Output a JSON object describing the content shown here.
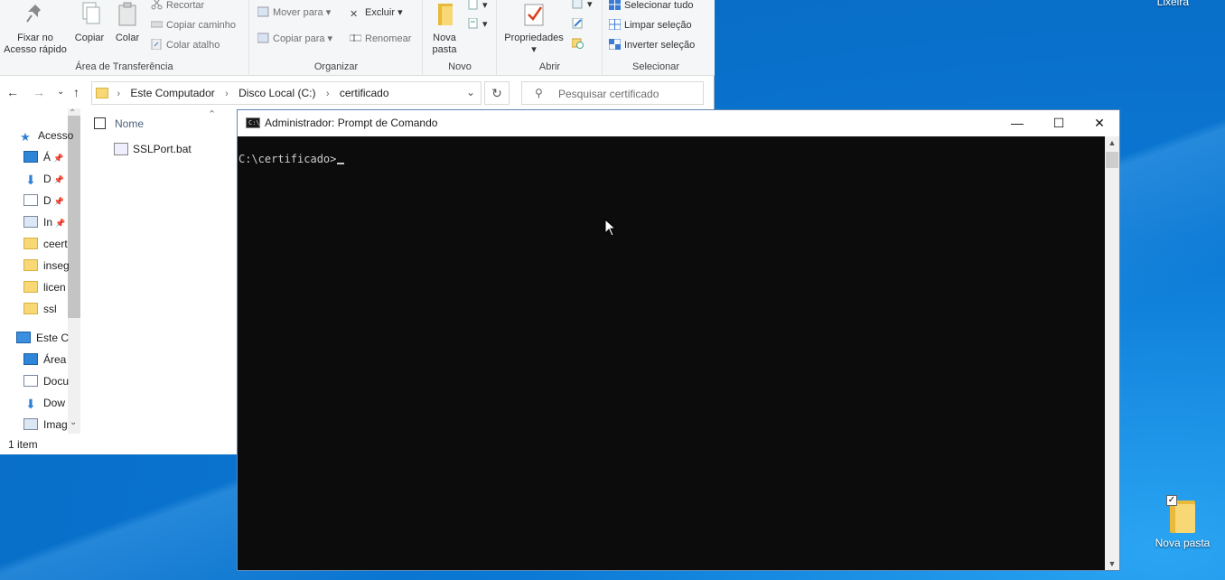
{
  "desktop": {
    "top_label": "Lixeira",
    "icon_label": "Nova pasta"
  },
  "ribbon": {
    "clipboard": {
      "group_label": "Área de Transferência",
      "pin_label_1": "Fixar no",
      "pin_label_2": "Acesso rápido",
      "copy": "Copiar",
      "paste": "Colar",
      "cut": "Recortar",
      "copy_path": "Copiar caminho",
      "paste_shortcut": "Colar atalho"
    },
    "organize": {
      "group_label": "Organizar",
      "move_to": "Mover para",
      "copy_to": "Copiar para",
      "delete": "Excluir",
      "rename": "Renomear"
    },
    "new": {
      "group_label": "Novo",
      "new_folder_1": "Nova",
      "new_folder_2": "pasta"
    },
    "open": {
      "group_label": "Abrir",
      "properties": "Propriedades"
    },
    "select": {
      "group_label": "Selecionar",
      "select_all": "Selecionar tudo",
      "clear_selection": "Limpar seleção",
      "invert_selection": "Inverter seleção"
    }
  },
  "address_bar": {
    "crumbs": [
      "Este Computador",
      "Disco Local (C:)",
      "certificado"
    ]
  },
  "search": {
    "placeholder": "Pesquisar certificado"
  },
  "nav_pane": {
    "items": [
      {
        "label": "Acesso",
        "icon": "star-icon"
      },
      {
        "label": "Á",
        "icon": "desktop-icon",
        "pinned": true
      },
      {
        "label": "D",
        "icon": "download-icon",
        "pinned": true
      },
      {
        "label": "D",
        "icon": "document-icon",
        "pinned": true
      },
      {
        "label": "In",
        "icon": "picture-icon",
        "pinned": true
      },
      {
        "label": "ceert",
        "icon": "folder-icon"
      },
      {
        "label": "inseg",
        "icon": "folder-icon"
      },
      {
        "label": "licen",
        "icon": "folder-icon"
      },
      {
        "label": "ssl",
        "icon": "folder-icon"
      },
      {
        "label": "Este C",
        "icon": "computer-icon"
      },
      {
        "label": "Área",
        "icon": "desktop-icon"
      },
      {
        "label": "Docu",
        "icon": "document-icon"
      },
      {
        "label": "Dow",
        "icon": "download-icon"
      },
      {
        "label": "Imag",
        "icon": "picture-icon"
      }
    ]
  },
  "file_list": {
    "column_name": "Nome",
    "files": [
      "SSLPort.bat"
    ]
  },
  "status_bar": {
    "count": "1 item"
  },
  "cmd": {
    "title": "Administrador: Prompt de Comando",
    "prompt": "C:\\certificado>",
    "icon_text": "C:\\"
  }
}
